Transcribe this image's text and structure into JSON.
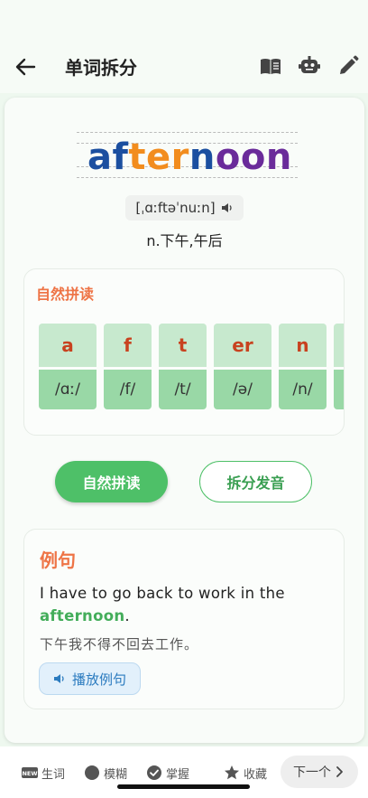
{
  "header": {
    "title": "单词拆分",
    "icons": [
      "back-arrow-icon",
      "book-icon",
      "robot-icon",
      "edit-icon"
    ]
  },
  "word": {
    "letters": [
      {
        "t": "a",
        "c": "#1b4fa0"
      },
      {
        "t": "f",
        "c": "#1b4fa0"
      },
      {
        "t": "t",
        "c": "#f28d1e"
      },
      {
        "t": "e",
        "c": "#f28d1e"
      },
      {
        "t": "r",
        "c": "#f28d1e"
      },
      {
        "t": "n",
        "c": "#1b4fa0"
      },
      {
        "t": "o",
        "c": "#6a2b9a"
      },
      {
        "t": "o",
        "c": "#6a2b9a"
      },
      {
        "t": "n",
        "c": "#6a2b9a"
      }
    ],
    "phonetic": "[ˌɑːftəˈnuːn]",
    "meaning": "n.下午,午后"
  },
  "phonics": {
    "title": "自然拼读",
    "tiles": [
      {
        "grapheme": "a",
        "ipa": "/ɑː/"
      },
      {
        "grapheme": "f",
        "ipa": "/f/"
      },
      {
        "grapheme": "t",
        "ipa": "/t/"
      },
      {
        "grapheme": "er",
        "ipa": "/ə/"
      },
      {
        "grapheme": "n",
        "ipa": "/n/"
      },
      {
        "grapheme": "",
        "ipa": ""
      }
    ]
  },
  "buttons": {
    "phonics": "自然拼读",
    "split": "拆分发音"
  },
  "example": {
    "title": "例句",
    "sentence_before": "I have to go back to work in the ",
    "keyword": "afternoon",
    "sentence_after": ".",
    "translation": "下午我不得不回去工作。",
    "play_label": "播放例句"
  },
  "bottom": {
    "new_word": "生词",
    "blurry": "模糊",
    "mastered": "掌握",
    "favorite": "收藏",
    "next": "下一个",
    "new_badge": "NEW"
  },
  "colors": {
    "accent_green": "#4ec068",
    "accent_orange": "#ee7446"
  }
}
